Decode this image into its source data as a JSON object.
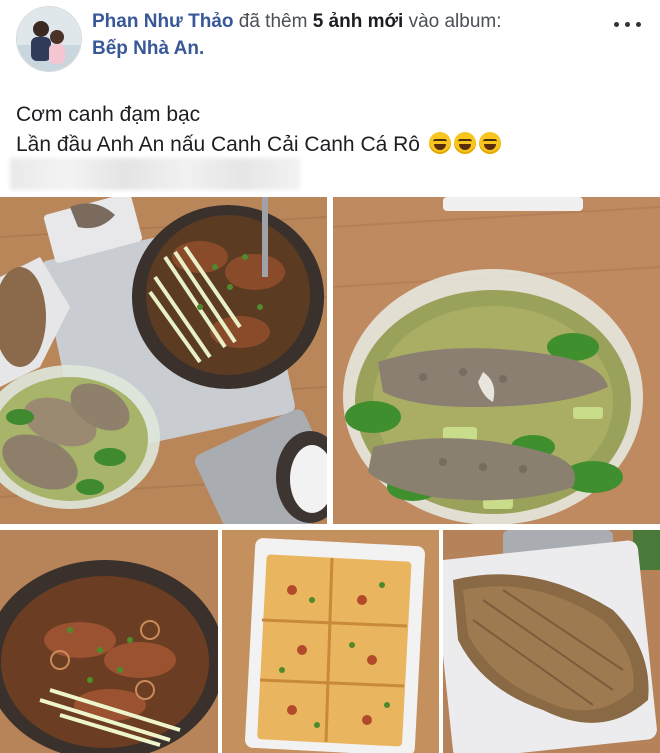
{
  "post": {
    "author": "Phan Như Thảo",
    "action": "đã thêm",
    "count_label": "5 ảnh mới",
    "preposition": "vào album:",
    "album": "Bếp Nhà An.",
    "text_line1": "Cơm canh đạm bạc",
    "text_line2": "Lần đầu Anh An nấu Canh Cải Canh Cá Rô"
  },
  "icons": {
    "more": "more-horizontal-icon",
    "emoji": "grinning-squinting-face"
  },
  "colors": {
    "link": "#385898",
    "table_wood": "#b88358",
    "broth": "#8a9a4a"
  }
}
